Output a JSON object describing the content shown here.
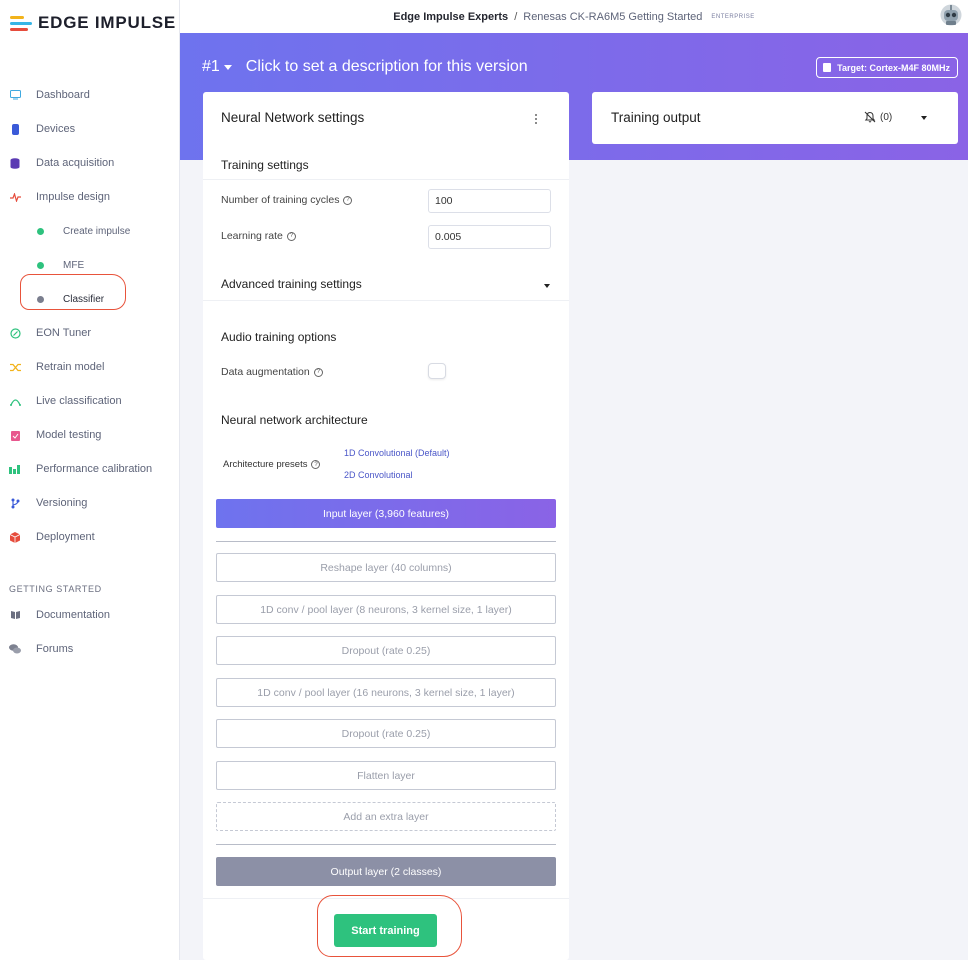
{
  "brand": {
    "name": "EDGE IMPULSE",
    "colors": [
      "#f2b31b",
      "#37b5e5",
      "#e64c3c"
    ]
  },
  "header": {
    "org": "Edge Impulse Experts",
    "separator": "/",
    "project": "Renesas CK-RA6M5 Getting Started",
    "badge": "ENTERPRISE"
  },
  "sidebar": {
    "items": [
      {
        "label": "Dashboard",
        "icon": "monitor-icon",
        "color": "#3fa9e0"
      },
      {
        "label": "Devices",
        "icon": "chip-icon",
        "color": "#3a5ad8"
      },
      {
        "label": "Data acquisition",
        "icon": "database-icon",
        "color": "#5b3ab3"
      },
      {
        "label": "Impulse design",
        "icon": "pulse-icon",
        "color": "#e64c3c"
      }
    ],
    "sub_items": [
      {
        "label": "Create impulse",
        "color": "#2ec27e"
      },
      {
        "label": "MFE",
        "color": "#2ec27e"
      },
      {
        "label": "Classifier",
        "color": "#7a7e8e"
      }
    ],
    "items2": [
      {
        "label": "EON Tuner",
        "icon": "compass-icon",
        "color": "#2ec27e"
      },
      {
        "label": "Retrain model",
        "icon": "shuffle-icon",
        "color": "#f2b31b"
      },
      {
        "label": "Live classification",
        "icon": "signal-icon",
        "color": "#2ec27e"
      },
      {
        "label": "Model testing",
        "icon": "clipboard-check-icon",
        "color": "#e8578e"
      },
      {
        "label": "Performance calibration",
        "icon": "bar-chart-icon",
        "color": "#2ec27e"
      },
      {
        "label": "Versioning",
        "icon": "branch-icon",
        "color": "#3a5ad8"
      },
      {
        "label": "Deployment",
        "icon": "cube-icon",
        "color": "#e64c3c"
      }
    ],
    "section_label": "GETTING STARTED",
    "getting_started": [
      {
        "label": "Documentation",
        "icon": "book-icon"
      },
      {
        "label": "Forums",
        "icon": "chat-icon"
      }
    ]
  },
  "banner": {
    "version": "#1",
    "description_placeholder": "Click to set a description for this version",
    "target": "Target: Cortex-M4F 80MHz"
  },
  "nn": {
    "title": "Neural Network settings",
    "training_settings": "Training settings",
    "cycles_label": "Number of training cycles",
    "cycles_value": "100",
    "lr_label": "Learning rate",
    "lr_value": "0.005",
    "advanced": "Advanced training settings",
    "audio_options": "Audio training options",
    "augmentation_label": "Data augmentation",
    "augmentation_enabled": false,
    "architecture": "Neural network architecture",
    "presets_label": "Architecture presets",
    "presets": [
      "1D Convolutional (Default)",
      "2D Convolutional"
    ],
    "input_layer": "Input layer (3,960 features)",
    "layers": [
      "Reshape layer (40 columns)",
      "1D conv / pool layer (8 neurons, 3 kernel size, 1 layer)",
      "Dropout (rate 0.25)",
      "1D conv / pool layer (16 neurons, 3 kernel size, 1 layer)",
      "Dropout (rate 0.25)",
      "Flatten layer"
    ],
    "add_layer": "Add an extra layer",
    "output_layer": "Output layer (2 classes)",
    "start_button": "Start training"
  },
  "output": {
    "title": "Training output",
    "notifications": "(0)"
  }
}
